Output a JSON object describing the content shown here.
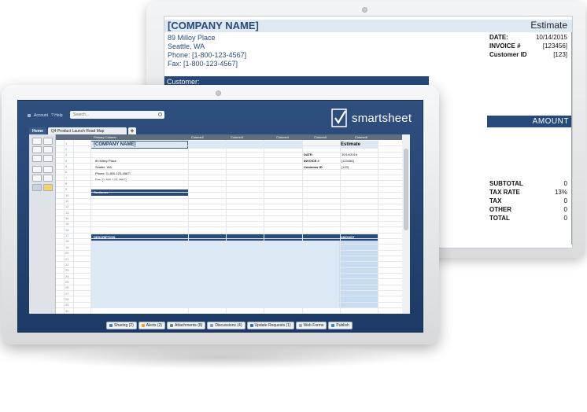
{
  "back_sheet": {
    "company": "[COMPANY NAME]",
    "doc_type": "Estimate",
    "address_lines": [
      "89 Milloy Place",
      "Seattle, WA",
      "Phone: [1-800-123-4567]",
      "Fax: [1-800-123-4567]"
    ],
    "meta": [
      {
        "label": "DATE:",
        "value": "10/14/2015"
      },
      {
        "label": "INVOICE #",
        "value": "[123456]"
      },
      {
        "label": "Customer ID",
        "value": "[123]"
      }
    ],
    "customer_label": "Customer:",
    "amount_label": "AMOUNT",
    "totals": [
      {
        "label": "SUBTOTAL",
        "value": "0"
      },
      {
        "label": "TAX RATE",
        "value": "13%"
      },
      {
        "label": "TAX",
        "value": "0"
      },
      {
        "label": "OTHER",
        "value": "0"
      },
      {
        "label": "TOTAL",
        "value": "0"
      }
    ]
  },
  "app": {
    "account_label": "Account",
    "help_label": "? Help",
    "search_placeholder": "Search...",
    "logo_text": "smartsheet",
    "home_tab": "Home",
    "sheet_tab": "Q4 Product Launch Road Map",
    "add_tab": "+",
    "columns": [
      "Primary Column",
      "Column2",
      "Column3",
      "Column4",
      "Column5",
      "Column6"
    ],
    "sheet": {
      "company": "[COMPANY NAME]",
      "estimate": "Estimate",
      "address_lines": [
        "89 Milloy Place",
        "Seattle, WA",
        "Phone: [1-800-123-4567]",
        "Fax: [1-800-123-4567]"
      ],
      "meta": [
        {
          "label": "DATE:",
          "value": "10/14/2015"
        },
        {
          "label": "INVOICE #",
          "value": "[123456]"
        },
        {
          "label": "Customer ID",
          "value": "[123]"
        }
      ],
      "customer_label": "Customer:",
      "description_label": "DESCRIPTION",
      "amount_label": "AMOUNT"
    },
    "row_numbers": [
      "1",
      "2",
      "3",
      "4",
      "5",
      "6",
      "7",
      "8",
      "9",
      "10",
      "11",
      "12",
      "13",
      "14",
      "15",
      "16",
      "17",
      "18",
      "19",
      "20",
      "21",
      "22",
      "23",
      "24",
      "25",
      "26",
      "27",
      "28",
      "29",
      "30"
    ],
    "bottom_buttons": [
      {
        "label": "Sharing (2)",
        "icon": "share-icon",
        "color": "#4a78b5"
      },
      {
        "label": "Alerts (2)",
        "icon": "alert-icon",
        "color": "#e0a82e"
      },
      {
        "label": "Attachments (8)",
        "icon": "paperclip-icon",
        "color": "#7a7a7a"
      },
      {
        "label": "Discussions (4)",
        "icon": "discussion-icon",
        "color": "#8a9bb0"
      },
      {
        "label": "Update Requests (1)",
        "icon": "update-request-icon",
        "color": "#3b6ab0"
      },
      {
        "label": "Web Forms",
        "icon": "web-form-icon",
        "color": "#9aa6b5"
      },
      {
        "label": "Publish",
        "icon": "publish-icon",
        "color": "#3d7cc9"
      }
    ]
  },
  "colors": {
    "brand_navy": "#274a7a",
    "header_light": "#dde8f3",
    "selection_blue": "#dbe9f7"
  }
}
